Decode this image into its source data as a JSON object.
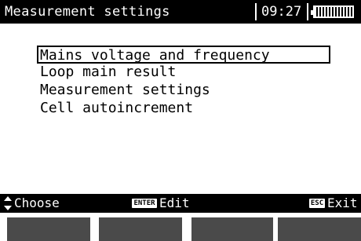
{
  "header": {
    "title": "Measurement settings",
    "time": "09:27",
    "battery_icon": "battery-icon"
  },
  "menu": {
    "items": [
      {
        "label": "Mains voltage and frequency",
        "selected": true
      },
      {
        "label": "Loop main result",
        "selected": false
      },
      {
        "label": "Measurement settings",
        "selected": false
      },
      {
        "label": "Cell autoincrement",
        "selected": false
      }
    ]
  },
  "statusbar": {
    "choose_icon": "up-down-arrow-icon",
    "choose_label": "Choose",
    "enter_key": "ENTER",
    "edit_label": "Edit",
    "esc_key": "ESC",
    "exit_label": "Exit"
  },
  "colors": {
    "bar": "#000000",
    "background": "#ffffff",
    "function_key": "#4a4a4a"
  }
}
